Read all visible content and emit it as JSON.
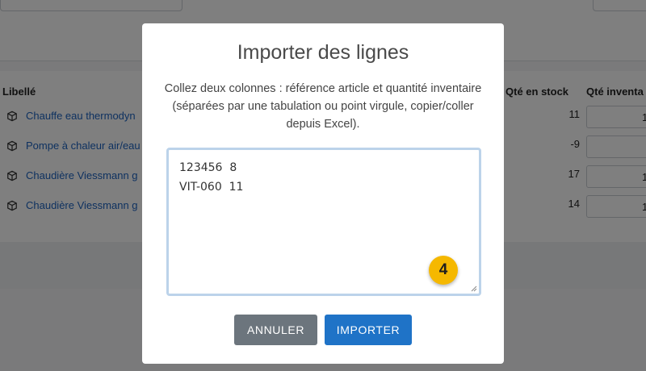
{
  "background": {
    "columns": {
      "label": "Libellé",
      "stock": "Qté en stock",
      "inventory": "Qté inventa"
    },
    "rows": [
      {
        "label": "Chauffe eau thermodyn",
        "stock": "11",
        "inventory": "1"
      },
      {
        "label": "Pompe à chaleur air/eau",
        "stock": "-9",
        "inventory": ""
      },
      {
        "label": "Chaudière Viessmann g",
        "stock": "17",
        "inventory": "1"
      },
      {
        "label": "Chaudière Viessmann g",
        "stock": "14",
        "inventory": "1"
      }
    ],
    "row_icon": "box-icon"
  },
  "modal": {
    "title": "Importer des lignes",
    "description": "Collez deux colonnes : référence article et quantité inventaire (séparées par une tabulation ou point virgule, copier/coller depuis Excel).",
    "textarea_lines": [
      "123456  8",
      "VIT-060  11"
    ],
    "badge": "4",
    "cancel_label": "ANNULER",
    "import_label": "IMPORTER"
  },
  "colors": {
    "link": "#1d63c0",
    "primary_button": "#1f73c7",
    "secondary_button": "#6c757d",
    "badge": "#f5b800",
    "textarea_focus_border": "#bcd3ea"
  }
}
